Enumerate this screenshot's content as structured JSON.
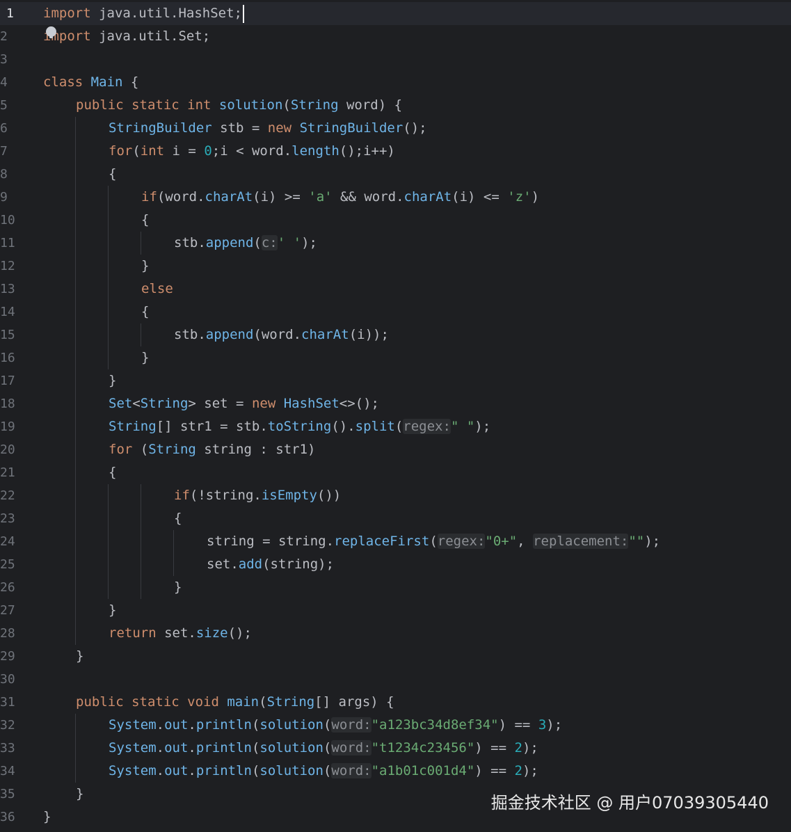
{
  "editor": {
    "active_line": 1,
    "lines": [
      {
        "n": "1",
        "indent": 0,
        "tokens": [
          [
            "kw",
            "import"
          ],
          [
            "id",
            " java.util.HashSet;"
          ]
        ]
      },
      {
        "n": "2",
        "indent": 0,
        "tokens": [
          [
            "kw",
            "import"
          ],
          [
            "id",
            " java.util.Set;"
          ]
        ]
      },
      {
        "n": "3",
        "indent": 0,
        "tokens": []
      },
      {
        "n": "4",
        "indent": 0,
        "tokens": [
          [
            "kw",
            "class"
          ],
          [
            "id",
            " "
          ],
          [
            "ty",
            "Main"
          ],
          [
            "id",
            " {"
          ]
        ]
      },
      {
        "n": "5",
        "indent": 1,
        "tokens": [
          [
            "kw",
            "public static int "
          ],
          [
            "fn",
            "solution"
          ],
          [
            "id",
            "("
          ],
          [
            "ty",
            "String"
          ],
          [
            "id",
            " word) {"
          ]
        ]
      },
      {
        "n": "6",
        "indent": 2,
        "tokens": [
          [
            "ty",
            "StringBuilder"
          ],
          [
            "id",
            " stb = "
          ],
          [
            "kw",
            "new "
          ],
          [
            "fn",
            "StringBuilder"
          ],
          [
            "id",
            "();"
          ]
        ]
      },
      {
        "n": "7",
        "indent": 2,
        "tokens": [
          [
            "kw",
            "for"
          ],
          [
            "id",
            "("
          ],
          [
            "kw",
            "int"
          ],
          [
            "id",
            " i = "
          ],
          [
            "num",
            "0"
          ],
          [
            "id",
            ";i < word."
          ],
          [
            "fn",
            "length"
          ],
          [
            "id",
            "();i++)"
          ]
        ]
      },
      {
        "n": "8",
        "indent": 2,
        "tokens": [
          [
            "id",
            "{"
          ]
        ]
      },
      {
        "n": "9",
        "indent": 3,
        "tokens": [
          [
            "kw",
            "if"
          ],
          [
            "id",
            "(word."
          ],
          [
            "fn",
            "charAt"
          ],
          [
            "id",
            "(i) >= "
          ],
          [
            "str",
            "'a'"
          ],
          [
            "id",
            " && word."
          ],
          [
            "fn",
            "charAt"
          ],
          [
            "id",
            "(i) <= "
          ],
          [
            "str",
            "'z'"
          ],
          [
            "id",
            ")"
          ]
        ]
      },
      {
        "n": "10",
        "indent": 3,
        "tokens": [
          [
            "id",
            "{"
          ]
        ]
      },
      {
        "n": "11",
        "indent": 4,
        "tokens": [
          [
            "id",
            "stb."
          ],
          [
            "fn",
            "append"
          ],
          [
            "id",
            "("
          ],
          [
            "hint",
            "c:"
          ],
          [
            "str",
            "' '"
          ],
          [
            "id",
            ");"
          ]
        ]
      },
      {
        "n": "12",
        "indent": 3,
        "tokens": [
          [
            "id",
            "}"
          ]
        ]
      },
      {
        "n": "13",
        "indent": 3,
        "tokens": [
          [
            "kw",
            "else"
          ]
        ]
      },
      {
        "n": "14",
        "indent": 3,
        "tokens": [
          [
            "id",
            "{"
          ]
        ]
      },
      {
        "n": "15",
        "indent": 4,
        "tokens": [
          [
            "id",
            "stb."
          ],
          [
            "fn",
            "append"
          ],
          [
            "id",
            "(word."
          ],
          [
            "fn",
            "charAt"
          ],
          [
            "id",
            "(i));"
          ]
        ]
      },
      {
        "n": "16",
        "indent": 3,
        "tokens": [
          [
            "id",
            "}"
          ]
        ]
      },
      {
        "n": "17",
        "indent": 2,
        "tokens": [
          [
            "id",
            "}"
          ]
        ]
      },
      {
        "n": "18",
        "indent": 2,
        "tokens": [
          [
            "ty",
            "Set"
          ],
          [
            "id",
            "<"
          ],
          [
            "ty",
            "String"
          ],
          [
            "id",
            "> set = "
          ],
          [
            "kw",
            "new "
          ],
          [
            "fn",
            "HashSet"
          ],
          [
            "id",
            "<>();"
          ]
        ]
      },
      {
        "n": "19",
        "indent": 2,
        "tokens": [
          [
            "ty",
            "String"
          ],
          [
            "id",
            "[] str1 = stb."
          ],
          [
            "fn",
            "toString"
          ],
          [
            "id",
            "()."
          ],
          [
            "fn",
            "split"
          ],
          [
            "id",
            "("
          ],
          [
            "hint",
            "regex:"
          ],
          [
            "str",
            "\" \""
          ],
          [
            "id",
            ");"
          ]
        ]
      },
      {
        "n": "20",
        "indent": 2,
        "tokens": [
          [
            "kw",
            "for"
          ],
          [
            "id",
            " ("
          ],
          [
            "ty",
            "String"
          ],
          [
            "id",
            " string : str1)"
          ]
        ]
      },
      {
        "n": "21",
        "indent": 2,
        "tokens": [
          [
            "id",
            "{"
          ]
        ]
      },
      {
        "n": "22",
        "indent": 4,
        "tokens": [
          [
            "kw",
            "if"
          ],
          [
            "id",
            "(!string."
          ],
          [
            "fn",
            "isEmpty"
          ],
          [
            "id",
            "())"
          ]
        ]
      },
      {
        "n": "23",
        "indent": 4,
        "tokens": [
          [
            "id",
            "{"
          ]
        ]
      },
      {
        "n": "24",
        "indent": 5,
        "tokens": [
          [
            "id",
            "string = string."
          ],
          [
            "fn",
            "replaceFirst"
          ],
          [
            "id",
            "("
          ],
          [
            "hint",
            "regex:"
          ],
          [
            "str",
            "\"0+\""
          ],
          [
            "id",
            ", "
          ],
          [
            "hint",
            "replacement:"
          ],
          [
            "str",
            "\"\""
          ],
          [
            "id",
            ");"
          ]
        ]
      },
      {
        "n": "25",
        "indent": 5,
        "tokens": [
          [
            "id",
            "set."
          ],
          [
            "fn",
            "add"
          ],
          [
            "id",
            "(string);"
          ]
        ]
      },
      {
        "n": "26",
        "indent": 4,
        "tokens": [
          [
            "id",
            "}"
          ]
        ]
      },
      {
        "n": "27",
        "indent": 2,
        "tokens": [
          [
            "id",
            "}"
          ]
        ]
      },
      {
        "n": "28",
        "indent": 2,
        "tokens": [
          [
            "kw",
            "return"
          ],
          [
            "id",
            " set."
          ],
          [
            "fn",
            "size"
          ],
          [
            "id",
            "();"
          ]
        ]
      },
      {
        "n": "29",
        "indent": 1,
        "tokens": [
          [
            "id",
            "}"
          ]
        ]
      },
      {
        "n": "30",
        "indent": 0,
        "tokens": []
      },
      {
        "n": "31",
        "indent": 1,
        "tokens": [
          [
            "kw",
            "public static void "
          ],
          [
            "fn",
            "main"
          ],
          [
            "id",
            "("
          ],
          [
            "ty",
            "String"
          ],
          [
            "id",
            "[] args) {"
          ]
        ]
      },
      {
        "n": "32",
        "indent": 2,
        "tokens": [
          [
            "ty",
            "System"
          ],
          [
            "id",
            "."
          ],
          [
            "ty",
            "out"
          ],
          [
            "id",
            "."
          ],
          [
            "fn",
            "println"
          ],
          [
            "id",
            "("
          ],
          [
            "fn",
            "solution"
          ],
          [
            "id",
            "("
          ],
          [
            "hint",
            "word:"
          ],
          [
            "str",
            "\"a123bc34d8ef34\""
          ],
          [
            "id",
            ") == "
          ],
          [
            "num",
            "3"
          ],
          [
            "id",
            ");"
          ]
        ]
      },
      {
        "n": "33",
        "indent": 2,
        "tokens": [
          [
            "ty",
            "System"
          ],
          [
            "id",
            "."
          ],
          [
            "ty",
            "out"
          ],
          [
            "id",
            "."
          ],
          [
            "fn",
            "println"
          ],
          [
            "id",
            "("
          ],
          [
            "fn",
            "solution"
          ],
          [
            "id",
            "("
          ],
          [
            "hint",
            "word:"
          ],
          [
            "str",
            "\"t1234c23456\""
          ],
          [
            "id",
            ") == "
          ],
          [
            "num",
            "2"
          ],
          [
            "id",
            ");"
          ]
        ]
      },
      {
        "n": "34",
        "indent": 2,
        "tokens": [
          [
            "ty",
            "System"
          ],
          [
            "id",
            "."
          ],
          [
            "ty",
            "out"
          ],
          [
            "id",
            "."
          ],
          [
            "fn",
            "println"
          ],
          [
            "id",
            "("
          ],
          [
            "fn",
            "solution"
          ],
          [
            "id",
            "("
          ],
          [
            "hint",
            "word:"
          ],
          [
            "str",
            "\"a1b01c001d4\""
          ],
          [
            "id",
            ") == "
          ],
          [
            "num",
            "2"
          ],
          [
            "id",
            ");"
          ]
        ]
      },
      {
        "n": "35",
        "indent": 1,
        "tokens": [
          [
            "id",
            "}"
          ]
        ]
      },
      {
        "n": "36",
        "indent": 0,
        "tokens": [
          [
            "id",
            "}"
          ]
        ]
      }
    ]
  },
  "watermark": "掘金技术社区 @ 用户07039305440",
  "colors": {
    "background": "#1e1f22",
    "keyword": "#cf8e6d",
    "type": "#6fb5e8",
    "string": "#6aab73",
    "number": "#2aacb8",
    "text": "#bcbec4"
  },
  "icons": {
    "intention_bulb": "lightbulb-icon"
  }
}
